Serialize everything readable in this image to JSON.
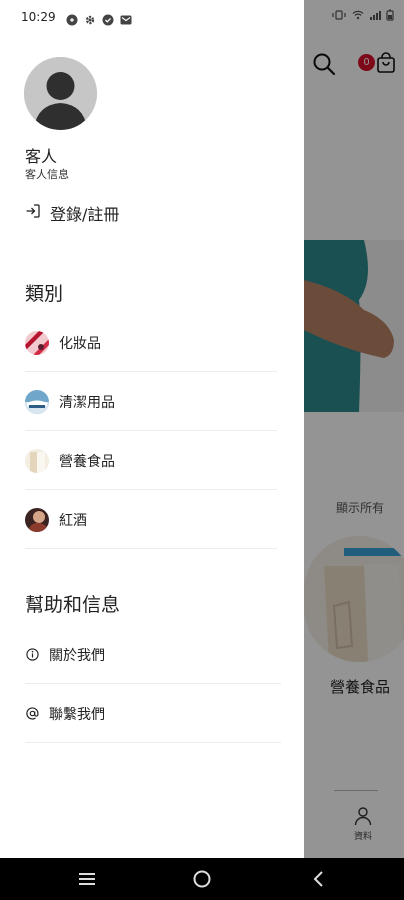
{
  "status_bar": {
    "time": "10:29"
  },
  "drawer": {
    "user": {
      "name": "客人",
      "info": "客人信息"
    },
    "login": {
      "label": "登錄/註冊"
    },
    "categories_title": "類別",
    "categories": [
      {
        "label": "化妝品",
        "icon": "cosmetics-thumbnail"
      },
      {
        "label": "清潔用品",
        "icon": "cleaning-thumbnail"
      },
      {
        "label": "營養食品",
        "icon": "nutrition-thumbnail"
      },
      {
        "label": "紅酒",
        "icon": "wine-thumbnail"
      }
    ],
    "help_title": "幫助和信息",
    "help_items": [
      {
        "label": "關於我們",
        "icon": "info-icon"
      },
      {
        "label": "聯繫我們",
        "icon": "at-icon"
      }
    ]
  },
  "background": {
    "cart_count": "0",
    "show_all": "顯示所有",
    "tile_label": "營養食品",
    "tab_label": "資料"
  },
  "colors": {
    "badge": "#d8102c",
    "scrim": "rgba(0,0,0,0.42)"
  }
}
